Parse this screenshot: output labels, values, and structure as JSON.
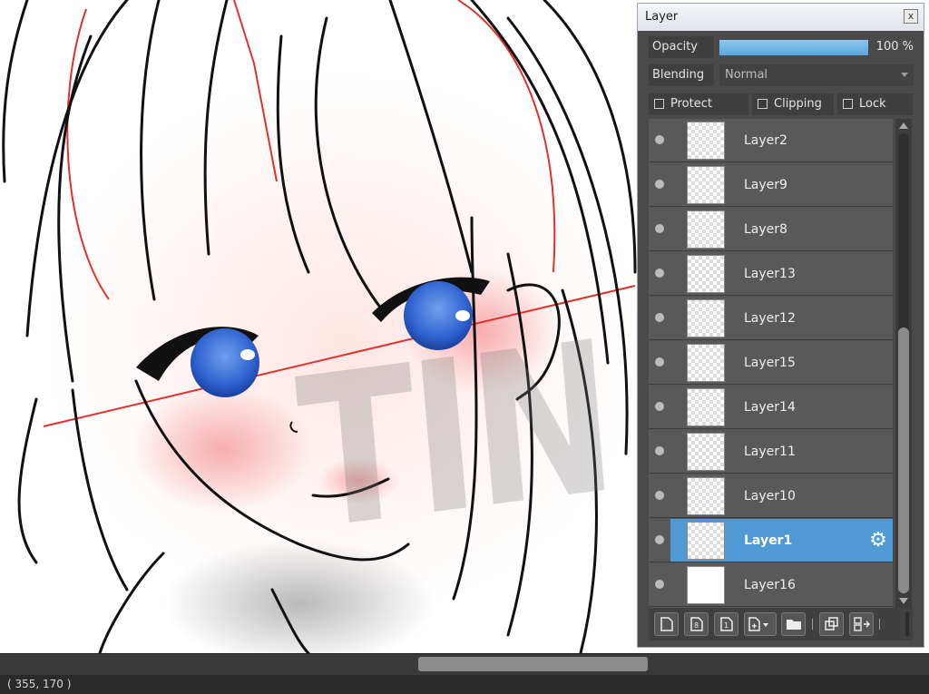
{
  "panel": {
    "title": "Layer",
    "close_label": "x",
    "opacity": {
      "label": "Opacity",
      "value": 100,
      "display": "100 %"
    },
    "blending": {
      "label": "Blending",
      "value": "Normal"
    },
    "checkboxes": [
      {
        "label": "Protect Alpha",
        "checked": false
      },
      {
        "label": "Clipping",
        "checked": false
      },
      {
        "label": "Lock",
        "checked": false
      }
    ],
    "layers": [
      {
        "name": "Layer2",
        "visible": true,
        "selected": false
      },
      {
        "name": "Layer9",
        "visible": true,
        "selected": false
      },
      {
        "name": "Layer8",
        "visible": true,
        "selected": false
      },
      {
        "name": "Layer13",
        "visible": true,
        "selected": false
      },
      {
        "name": "Layer12",
        "visible": true,
        "selected": false
      },
      {
        "name": "Layer15",
        "visible": true,
        "selected": false
      },
      {
        "name": "Layer14",
        "visible": true,
        "selected": false
      },
      {
        "name": "Layer11",
        "visible": true,
        "selected": false
      },
      {
        "name": "Layer10",
        "visible": true,
        "selected": false
      },
      {
        "name": "Layer1",
        "visible": true,
        "selected": true
      },
      {
        "name": "Layer16",
        "visible": true,
        "selected": false
      }
    ],
    "toolbar_icons": [
      "new-layer-icon",
      "new-8bit-layer-icon",
      "new-1bit-layer-icon",
      "add-layer-menu-icon",
      "new-folder-icon",
      "duplicate-layer-icon",
      "merge-down-icon"
    ],
    "accent_color": "#4f9ad6"
  },
  "canvas": {
    "watermark": "TIN",
    "eye_color": "#3a6fd6"
  },
  "status": {
    "coords": "( 355, 170 )"
  }
}
